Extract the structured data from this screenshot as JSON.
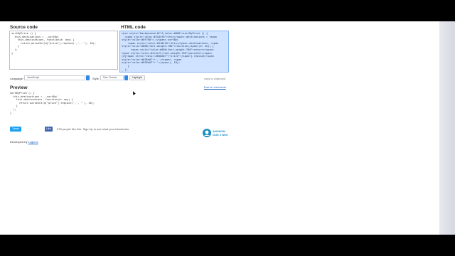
{
  "source_heading": "Source code",
  "html_heading": "HTML code",
  "preview_heading": "Preview",
  "source_code": "sortByPrice () {\n  this.destinations = _.sortBy(\n    this.destinations, function(d: any) {\n      return parseInt(d[\"price\"].replace(',', ''), 10);\n    }\n  );\n}",
  "html_code": "<pre style=\"background:#fff;color:#000\">sortByPrice () {\n  <span style=\"color:#3184f0\">this</span>.destinations = <span\nstyle=\"color:#0f7b8\">_</span>.sortBy(\n    <span style=\"color:#3184f0\">this</span>.destinations, <span\nstyle=\"color:#000;font-weight:700\">function</span>(d: any) {\n      <span style=\"color:#000;font-weight:700\">return</span>\n<span style=\"color:#3c4c72;font-weight:700\">parseInt</span>\n(d[<span style=\"color:#036a07\">\"price\"</span>].replace(<span\nstyle=\"color:#036a07\">','</span>, <span\nstyle=\"color:#036a07\">''</span>), 10);\n    }\n  );\n}</pre>",
  "language_label": "Language:",
  "language_value": "JavaScript",
  "style_label": "Style:",
  "style_value": "Mac Classic",
  "highlight_button": "Highlight",
  "copy_label": "copy to clipboard",
  "post_link": "Post to LiveJournal",
  "preview_code": "sortByPrice () {\n  this.destinations = _.sortBy(\n    this.destinations, function(d: any) {\n      return parseInt(d[\"price\"].replace(',', ''), 10);\n    }\n  );\n}",
  "tweet_label": "Tweet",
  "like_label": "Like",
  "like_text": "278 people like this. Sign Up to see what your friends like.",
  "logo_text_top": "ANONYM",
  "logo_text_bottom": "OUS ● NEX",
  "developed_label": "Developed by",
  "developed_link": "Loginov",
  "colors": {
    "accent": "#2f86e6",
    "selection": "#cfe2ff",
    "tweet": "#1da1f2",
    "facebook": "#4267b2",
    "logo": "#1b8fc2"
  }
}
